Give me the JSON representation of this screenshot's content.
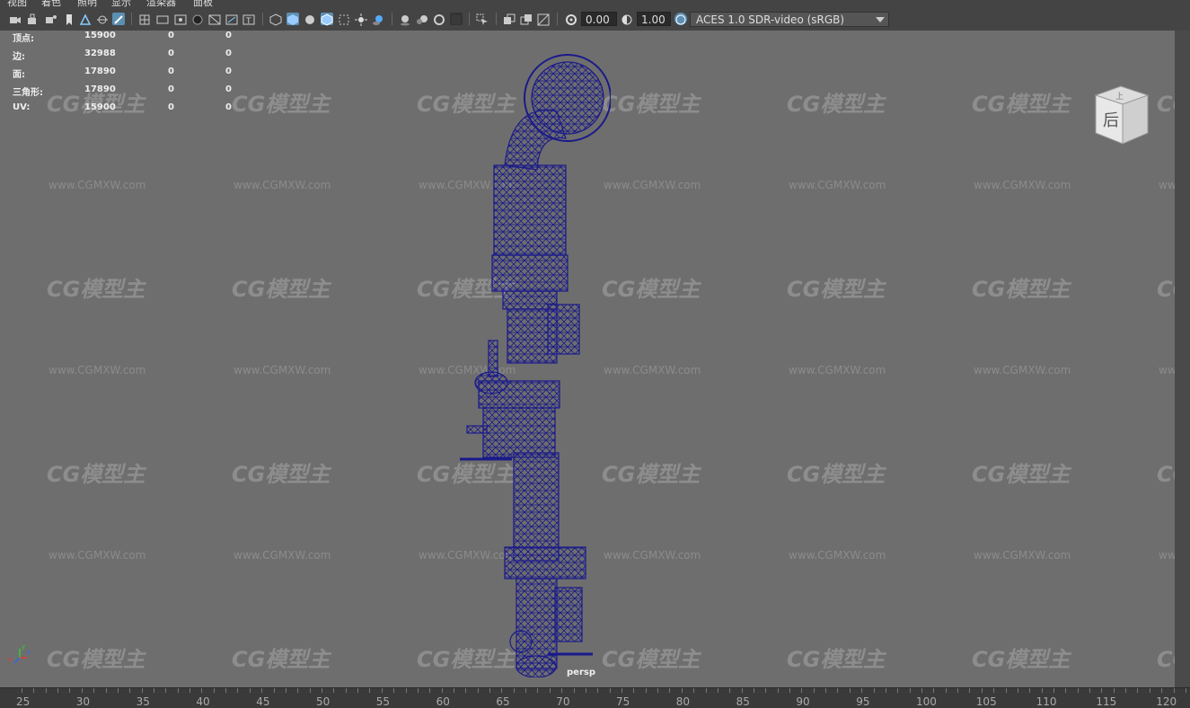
{
  "menu": {
    "items": [
      "视图",
      "着色",
      "照明",
      "显示",
      "渲染器",
      "面板"
    ]
  },
  "toolbar": {
    "exposure_value": "0.00",
    "gamma_value": "1.00",
    "color_space": "ACES 1.0 SDR-video (sRGB)",
    "icons": [
      "camera-icon",
      "camera-lock-icon",
      "camera-attr-icon",
      "bookmark-icon",
      "image-plane-icon",
      "2d-pan-icon",
      "grease-pencil-icon",
      "grid-icon",
      "film-gate-icon",
      "resolution-gate-icon",
      "gate-mask-icon",
      "field-chart-icon",
      "safe-action-icon",
      "safe-title-icon",
      "wireframe-icon",
      "smooth-shade-icon",
      "default-material-icon",
      "wireframe-on-shaded-icon",
      "xray-icon",
      "lights-icon",
      "shadows-icon",
      "screen-space-ao-icon",
      "motion-blur-icon",
      "anti-alias-icon",
      "depth-of-field-icon",
      "isolate-select-icon",
      "xray-joints-icon",
      "xray-active-icon",
      "bounding-box-icon",
      "exposure-icon",
      "gamma-icon",
      "color-management-icon"
    ],
    "accent_color": "#5d8fb3"
  },
  "hud": {
    "rows": [
      {
        "label": "顶点:",
        "v1": "15900",
        "v2": "0",
        "v3": "0"
      },
      {
        "label": "边:",
        "v1": "32988",
        "v2": "0",
        "v3": "0"
      },
      {
        "label": "面:",
        "v1": "17890",
        "v2": "0",
        "v3": "0"
      },
      {
        "label": "三角形:",
        "v1": "17890",
        "v2": "0",
        "v3": "0"
      },
      {
        "label": "UV:",
        "v1": "15900",
        "v2": "0",
        "v3": "0"
      }
    ]
  },
  "viewport": {
    "camera_label": "persp",
    "viewcube_label": "后",
    "viewcube_top": "上",
    "background_color": "#6e6e6e",
    "wireframe_color": "#1a1a8a",
    "axis": {
      "x": "x",
      "y": "y",
      "z": "z"
    }
  },
  "watermark": {
    "text": "CG模型主",
    "url": "www.CGMXW.com"
  },
  "timeline": {
    "ticks": [
      "25",
      "30",
      "35",
      "40",
      "45",
      "50",
      "55",
      "60",
      "65",
      "70",
      "75",
      "80",
      "85",
      "90",
      "95",
      "100",
      "105",
      "110",
      "115",
      "120"
    ]
  }
}
